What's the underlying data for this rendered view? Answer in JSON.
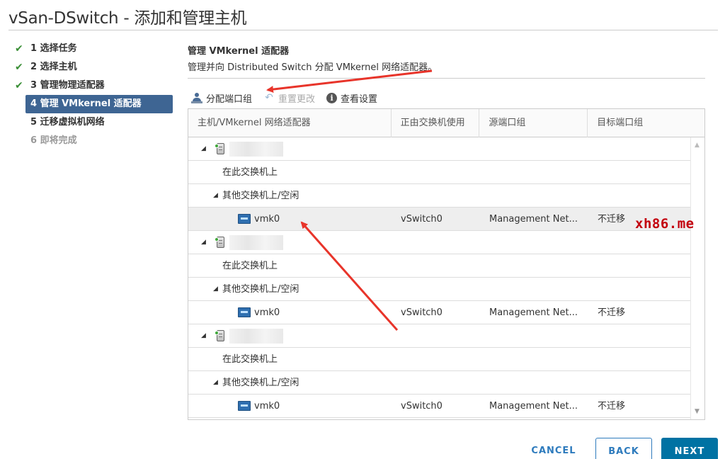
{
  "window": {
    "title": "vSan-DSwitch - 添加和管理主机"
  },
  "steps": [
    {
      "label": "1 选择任务",
      "state": "done"
    },
    {
      "label": "2 选择主机",
      "state": "done"
    },
    {
      "label": "3 管理物理适配器",
      "state": "done"
    },
    {
      "label": "4 管理 VMkernel 适配器",
      "state": "active"
    },
    {
      "label": "5 迁移虚拟机网络",
      "state": "pending"
    },
    {
      "label": "6 即将完成",
      "state": "disabled"
    }
  ],
  "section": {
    "title": "管理 VMkernel 适配器",
    "description": "管理并向 Distributed Switch 分配 VMkernel 网络适配器。"
  },
  "toolbar": {
    "assign_label": "分配端口组",
    "reset_label": "重置更改",
    "view_label": "查看设置"
  },
  "grid": {
    "headers": [
      "主机/VMkernel 网络适配器",
      "正由交换机使用",
      "源端口组",
      "目标端口组"
    ],
    "rows": {
      "on_switch": "在此交换机上",
      "other_switch": "其他交换机上/空闲",
      "nic_name": "vmk0",
      "in_use_by": "vSwitch0",
      "source_pg": "Management Net...",
      "target_pg": "不迁移"
    }
  },
  "icons": {
    "assign": "assign-portgroup-icon",
    "reset": "undo-icon",
    "info": "info-icon",
    "host": "host-icon",
    "nic": "network-adapter-icon",
    "check": "checkmark-icon"
  },
  "colors": {
    "active_step": "#3e6593",
    "check": "#3a8f36",
    "primary": "#0072a3",
    "link": "#2e7bbd",
    "annotation": "#e8342a",
    "watermark": "#c3000d"
  },
  "watermark": "xh86.me",
  "footer": {
    "cancel": "CANCEL",
    "back": "BACK",
    "next": "NEXT"
  }
}
